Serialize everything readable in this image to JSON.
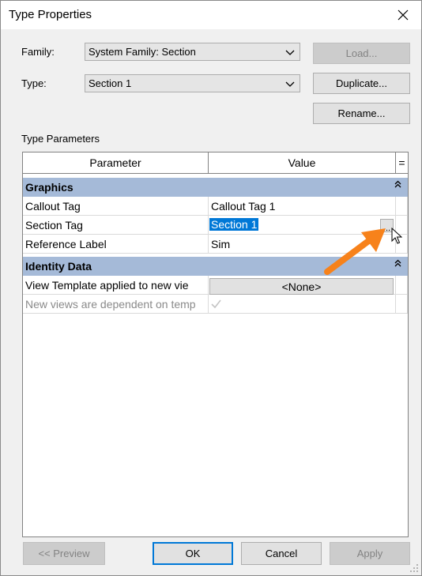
{
  "window": {
    "title": "Type Properties"
  },
  "form": {
    "family_label": "Family:",
    "family_value": "System Family: Section",
    "type_label": "Type:",
    "type_value": "Section 1"
  },
  "buttons": {
    "load": "Load...",
    "duplicate": "Duplicate...",
    "rename": "Rename...",
    "preview": "<< Preview",
    "ok": "OK",
    "cancel": "Cancel",
    "apply": "Apply"
  },
  "section_title": "Type Parameters",
  "grid": {
    "headers": {
      "parameter": "Parameter",
      "value": "Value",
      "equals": "="
    },
    "groups": [
      {
        "name": "Graphics",
        "rows": [
          {
            "parameter": "Callout Tag",
            "value": "Callout Tag 1"
          },
          {
            "parameter": "Section Tag",
            "value": "Section 1",
            "ellipsis": "..."
          },
          {
            "parameter": "Reference Label",
            "value": "Sim"
          }
        ]
      },
      {
        "name": "Identity Data",
        "rows": [
          {
            "parameter": "View Template applied to new vie",
            "value": "<None>"
          },
          {
            "parameter": "New views are dependent on temp",
            "value": ""
          }
        ]
      }
    ]
  },
  "colors": {
    "group_header": "#a5bad8",
    "selection": "#0078d7",
    "annotation_arrow": "#f7821b",
    "default_button_border": "#0078d7"
  },
  "icons": {
    "close": "close-icon",
    "dropdown": "chevron-down-icon",
    "collapse": "double-chevron-up-icon",
    "cursor": "mouse-pointer-icon",
    "arrow": "annotation-arrow-icon",
    "checkbox": "checkmark-icon",
    "resize": "resize-grip-icon"
  }
}
